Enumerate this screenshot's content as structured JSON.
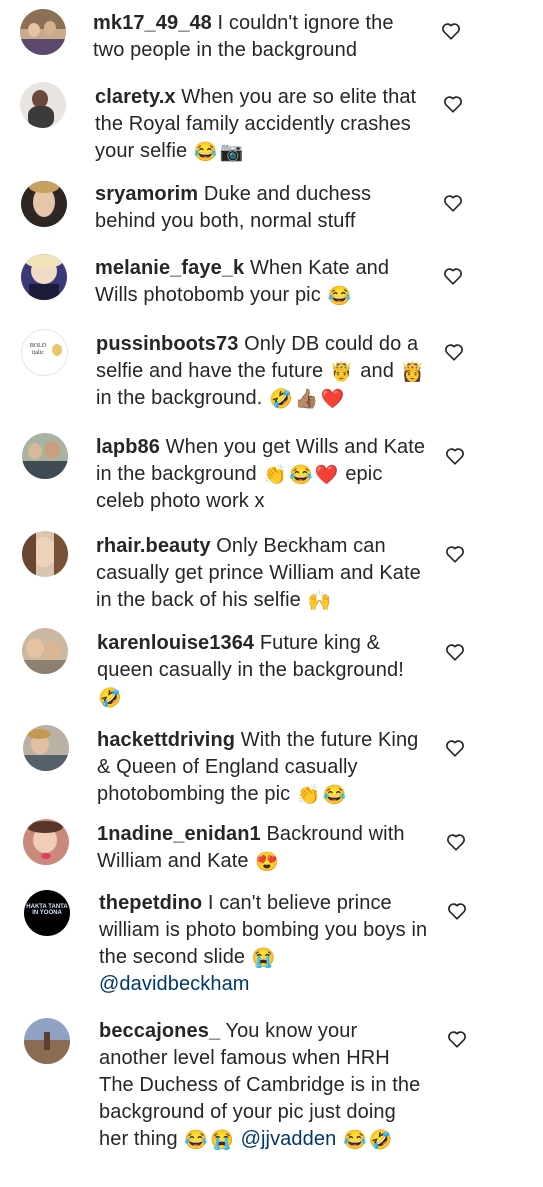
{
  "colors": {
    "text": "#262626",
    "mention": "#00376b",
    "heart_stroke": "#262626"
  },
  "icons": {
    "heart": "heart-outline-icon"
  },
  "comments": [
    {
      "username": "mk17_49_48",
      "text_1": " I couldn't ignore the two people in the background"
    },
    {
      "username": "clarety.x",
      "text_1": " When you are so elite that the Royal family accidently crashes your selfie ",
      "emoji_1": "😂",
      "emoji_2": "📷"
    },
    {
      "username": "sryamorim",
      "text_1": " Duke and duchess behind you both, normal stuff"
    },
    {
      "username": "melanie_faye_k",
      "text_1": " When Kate and Wills photobomb your pic ",
      "emoji_1": "😂"
    },
    {
      "username": "pussinboots73",
      "text_1": " Only DB could do a selfie and have the future ",
      "emoji_1": "🤴",
      "text_2": " and ",
      "emoji_2": "👸",
      "text_3": " in the background. ",
      "emoji_3": "🤣",
      "emoji_4": "👍🏽",
      "emoji_5": "❤️"
    },
    {
      "username": "lapb86",
      "text_1": " When you get Wills and Kate in the background ",
      "emoji_1": "👏",
      "emoji_2": "😂",
      "emoji_3": "❤️",
      "text_2": " epic celeb photo work x"
    },
    {
      "username": "rhair.beauty",
      "text_1": " Only Beckham can casually get prince William and Kate in the back of his selfie ",
      "emoji_1": "🙌"
    },
    {
      "username": "karenlouise1364",
      "text_1": " Future king & queen casually in the background! ",
      "emoji_1": "🤣"
    },
    {
      "username": "hackettdriving",
      "text_1": " With the future King & Queen of England casually photobombing the pic ",
      "emoji_1": "👏",
      "emoji_2": "😂"
    },
    {
      "username": "1nadine_enidan1",
      "text_1": " Backround with William and Kate ",
      "emoji_1": "😍"
    },
    {
      "username": "thepetdino",
      "text_1": " I can't believe prince william is photo bombing you boys in the second slide ",
      "emoji_1": "😭",
      "mention": "@davidbeckham"
    },
    {
      "username": "beccajones_",
      "text_1": " You know your another level famous when HRH The Duchess of Cambridge is in the background of your pic just doing her thing ",
      "emoji_1": "😂",
      "emoji_2": "😭",
      "mention": "@jjvadden",
      "emoji_3": "😂",
      "emoji_4": "🤣"
    }
  ],
  "avatar_texts": {
    "pussinboots73": "BOLD italic",
    "thepetdino": "HAKTA TANTA IN YOONA"
  }
}
